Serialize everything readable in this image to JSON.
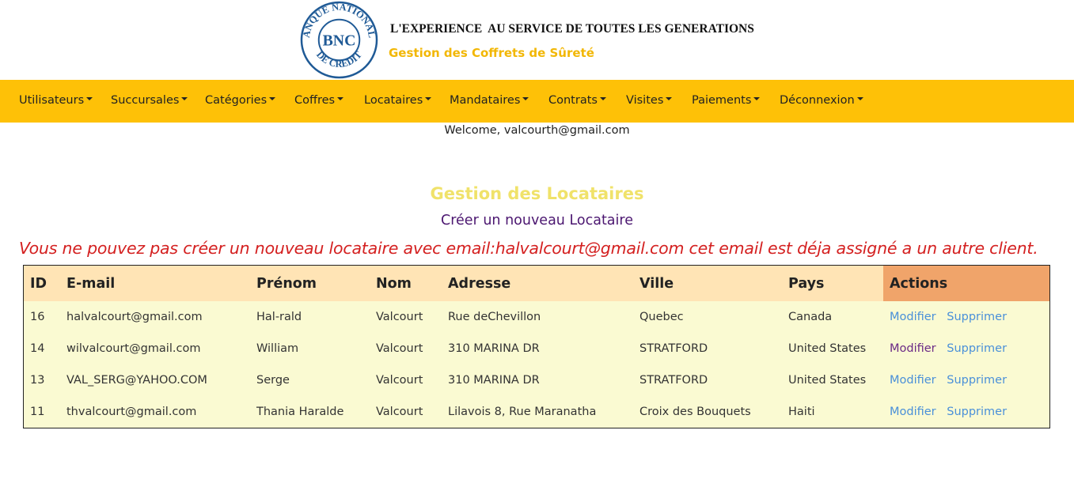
{
  "header": {
    "logo_text": "BNC",
    "logo_ring_text": "BANQUE NATIONALE DE CREDIT",
    "slogan": "L'EXPERIENCE  AU SERVICE DE TOUTES LES GENERATIONS",
    "subtitle": "Gestion des Coffrets de Sûreté"
  },
  "nav": {
    "items": [
      {
        "label": "Utilisateurs"
      },
      {
        "label": "Succursales"
      },
      {
        "label": "Catégories"
      },
      {
        "label": "Coffres"
      },
      {
        "label": "Locataires"
      },
      {
        "label": "Mandataires"
      },
      {
        "label": "Contrats"
      },
      {
        "label": "Visites"
      },
      {
        "label": "Paiements"
      },
      {
        "label": "Déconnexion"
      }
    ]
  },
  "welcome": "Welcome, valcourth@gmail.com",
  "section_title": "Gestion des Locataires",
  "create_link": "Créer un nouveau Locataire",
  "error_message": "Vous ne pouvez pas créer un nouveau locataire avec email:halvalcourt@gmail.com cet email est déja assigné a un autre client.",
  "table": {
    "headers": {
      "id": "ID",
      "email": "E-mail",
      "prenom": "Prénom",
      "nom": "Nom",
      "adresse": "Adresse",
      "ville": "Ville",
      "pays": "Pays",
      "actions": "Actions"
    },
    "action_labels": {
      "edit": "Modifier",
      "delete": "Supprimer"
    },
    "rows": [
      {
        "id": "16",
        "email": "halvalcourt@gmail.com",
        "prenom": "Hal-rald",
        "nom": "Valcourt",
        "adresse": "Rue deChevillon",
        "ville": "Quebec",
        "pays": "Canada"
      },
      {
        "id": "14",
        "email": "wilvalcourt@gmail.com",
        "prenom": "William",
        "nom": "Valcourt",
        "adresse": "310 MARINA DR",
        "ville": "STRATFORD",
        "pays": "United States"
      },
      {
        "id": "13",
        "email": "VAL_SERG@YAHOO.COM",
        "prenom": "Serge",
        "nom": "Valcourt",
        "adresse": "310 MARINA DR",
        "ville": "STRATFORD",
        "pays": "United States"
      },
      {
        "id": "11",
        "email": "thvalcourt@gmail.com",
        "prenom": "Thania Haralde",
        "nom": "Valcourt",
        "adresse": "Lilavois 8, Rue Maranatha",
        "ville": "Croix des Bouquets",
        "pays": "Haiti"
      }
    ]
  },
  "colors": {
    "navbar": "#fec107",
    "subtitle": "#f2b705",
    "section_title": "#f0e26a",
    "create_link": "#4b1670",
    "error": "#d42020",
    "table_header": "#ffe4b5",
    "actions_header": "#f0a46a",
    "table_body": "#fafad2",
    "action_link": "#4a90d9",
    "visited_link": "#6b2a86"
  }
}
